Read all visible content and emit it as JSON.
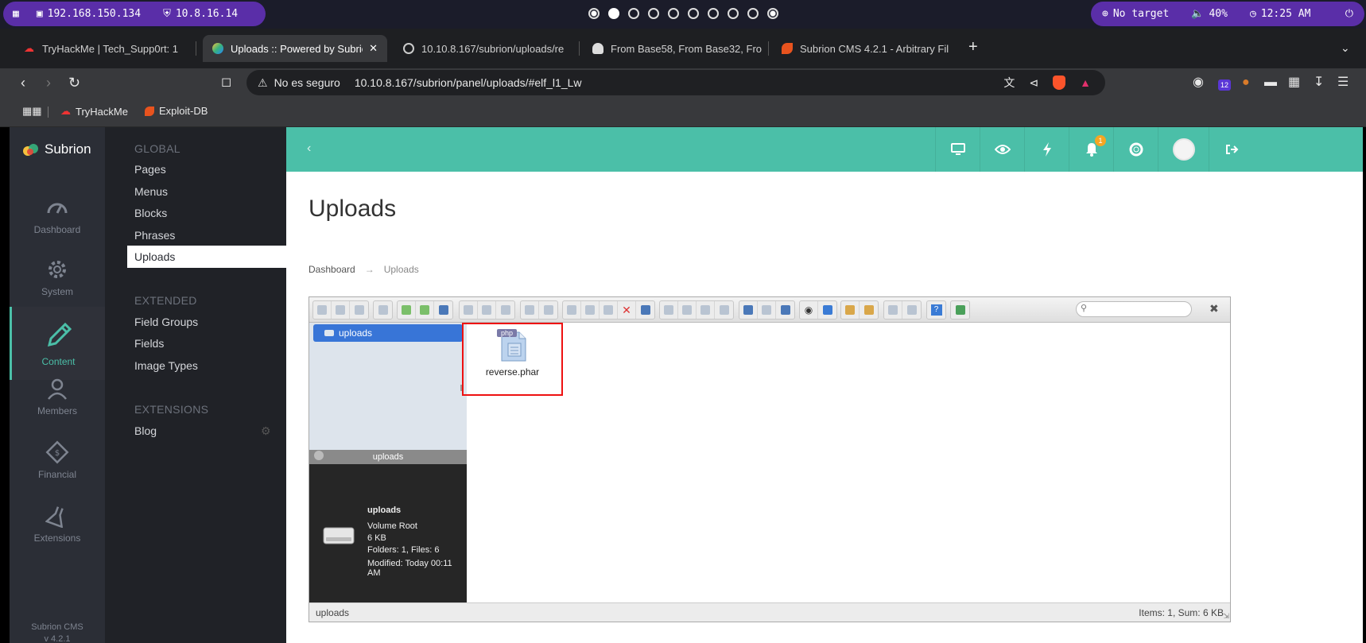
{
  "sysbar": {
    "ip_local": "192.168.150.134",
    "ip_vpn": "10.8.16.14",
    "target": "No target",
    "volume": "40%",
    "clock": "12:25 AM"
  },
  "tabs": [
    {
      "label": "TryHackMe | Tech_Supp0rt: 1"
    },
    {
      "label": "Uploads :: Powered by Subrion"
    },
    {
      "label": "10.10.8.167/subrion/uploads/re"
    },
    {
      "label": "From Base58, From Base32, Fro"
    },
    {
      "label": "Subrion CMS 4.2.1 - Arbitrary Fil"
    }
  ],
  "address": {
    "security": "No es seguro",
    "url": "10.10.8.167/subrion/panel/uploads/#elf_l1_Lw",
    "ext_badge": "12"
  },
  "bookmarks": [
    {
      "label": "TryHackMe"
    },
    {
      "label": "Exploit-DB"
    }
  ],
  "cms": {
    "brand": "Subrion",
    "version_line1": "Subrion CMS",
    "version_line2": "v 4.2.1",
    "rail": [
      {
        "label": "Dashboard"
      },
      {
        "label": "System"
      },
      {
        "label": "Content"
      },
      {
        "label": "Members"
      },
      {
        "label": "Financial"
      },
      {
        "label": "Extensions"
      }
    ],
    "subnav": {
      "global_header": "GLOBAL",
      "global": [
        "Pages",
        "Menus",
        "Blocks",
        "Phrases",
        "Uploads"
      ],
      "extended_header": "EXTENDED",
      "extended": [
        "Field Groups",
        "Fields",
        "Image Types"
      ],
      "extensions_header": "EXTENSIONS",
      "extensions": [
        "Blog"
      ]
    },
    "notifications": "1",
    "page_title": "Uploads",
    "breadcrumb": {
      "home": "Dashboard",
      "arrow": "→",
      "current": "Uploads"
    }
  },
  "file_manager": {
    "tree_root": "uploads",
    "info_header": "uploads",
    "info": {
      "name": "uploads",
      "kind": "Volume Root",
      "size": "6 KB",
      "counts": "Folders: 1, Files: 6",
      "modified": "Modified: Today 00:11 AM"
    },
    "file": {
      "name": "reverse.phar",
      "badge": "php"
    },
    "status_path": "uploads",
    "status_summary": "Items: 1, Sum: 6 KB"
  },
  "colors": {
    "accent": "#4bbfa8",
    "selection": "#3875d7",
    "highlight_box": "#e11111",
    "sysbar_pill": "#5a2ea8"
  }
}
